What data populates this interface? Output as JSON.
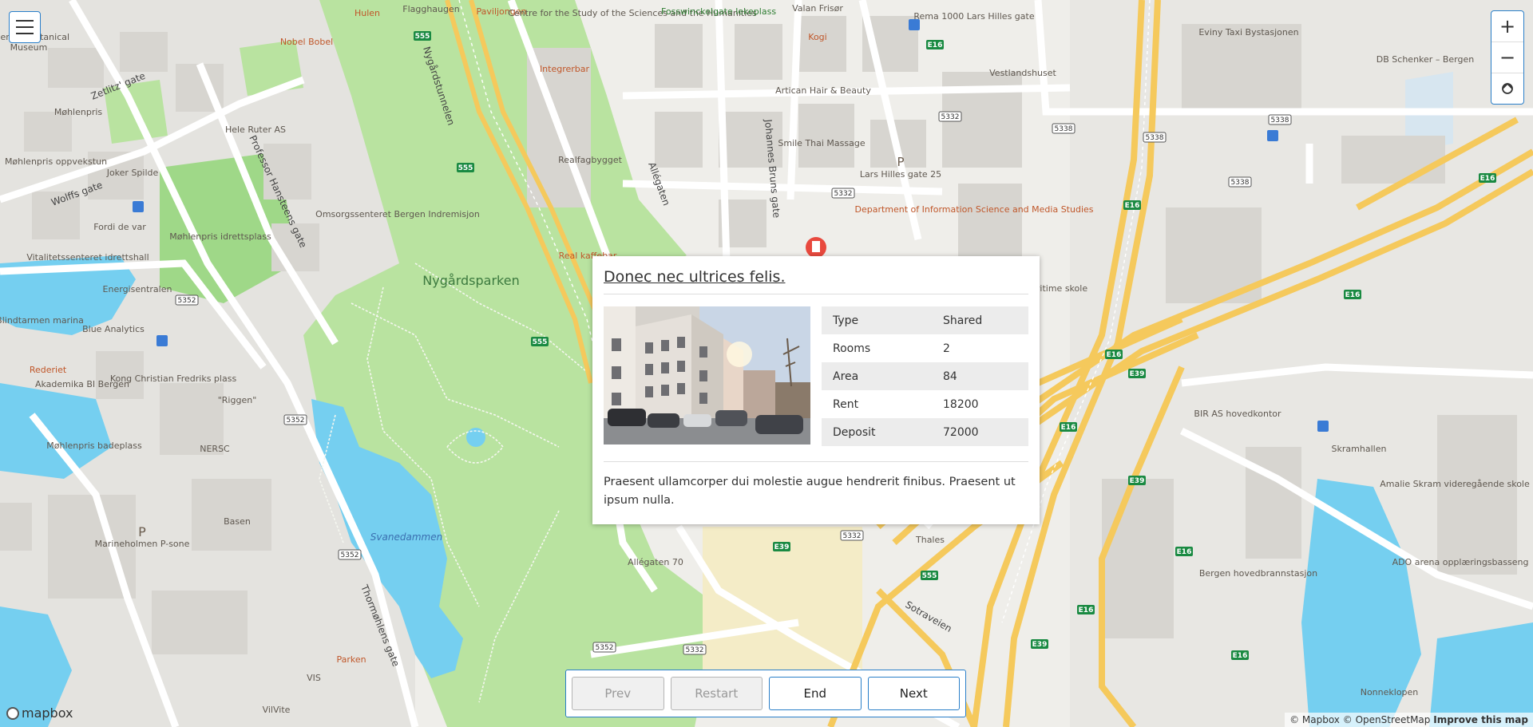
{
  "map": {
    "park_name": "Nygårdsparken",
    "lake_name": "Svanedammen",
    "streets": [
      "Nygårdstunnelen",
      "Professor Hansteens gate",
      "Johannes Bruns gate",
      "Allégaten",
      "Thormøhlens gate",
      "Sotraveien",
      "Zetlitz' gate",
      "Wolffs gate"
    ],
    "labels": [
      {
        "text": "Hulen",
        "kind": "food"
      },
      {
        "text": "Flagghaugen",
        "kind": "plain"
      },
      {
        "text": "Paviljongen",
        "kind": "food"
      },
      {
        "text": "Centre for the Study of the Sciences and the Humanities",
        "kind": "plain"
      },
      {
        "text": "Fosswinckelgate lekeplass",
        "kind": "green"
      },
      {
        "text": "Valan Frisør",
        "kind": "plain"
      },
      {
        "text": "Kogi",
        "kind": "food"
      },
      {
        "text": "Rema 1000 Lars Hilles gate",
        "kind": "plain"
      },
      {
        "text": "Eviny Taxi Bystasjonen",
        "kind": "plain"
      },
      {
        "text": "DB Schenker – Bergen",
        "kind": "plain"
      },
      {
        "text": "Nobel Bobel",
        "kind": "food"
      },
      {
        "text": "Integrerbar",
        "kind": "food"
      },
      {
        "text": "Vestlandshuset",
        "kind": "plain"
      },
      {
        "text": "Artican Hair & Beauty",
        "kind": "plain"
      },
      {
        "text": "Møhlenpris",
        "kind": "plain"
      },
      {
        "text": "Hele Ruter AS",
        "kind": "plain"
      },
      {
        "text": "Smile Thai Massage",
        "kind": "plain"
      },
      {
        "text": "Realfagbygget",
        "kind": "plain"
      },
      {
        "text": "Lars Hilles gate 25",
        "kind": "plain"
      },
      {
        "text": "Møhlenpris oppvekstun",
        "kind": "plain"
      },
      {
        "text": "Joker Spilde",
        "kind": "plain"
      },
      {
        "text": "Department of Information Science and Media Studies",
        "kind": "plain"
      },
      {
        "text": "Fordi de var",
        "kind": "plain"
      },
      {
        "text": "Møhlenpris idrettsplass",
        "kind": "plain"
      },
      {
        "text": "Omsorgssenteret Bergen Indremisjon",
        "kind": "plain"
      },
      {
        "text": "Real kaffebar",
        "kind": "food"
      },
      {
        "text": "Vitalitetssenteret idrettshall",
        "kind": "plain"
      },
      {
        "text": "Energisentralen",
        "kind": "plain"
      },
      {
        "text": "Blindtarmen marina",
        "kind": "plain"
      },
      {
        "text": "Blue Analytics",
        "kind": "plain"
      },
      {
        "text": "Rederiet",
        "kind": "food"
      },
      {
        "text": "Akademika BI Bergen",
        "kind": "plain"
      },
      {
        "text": "Kong Christian Fredriks plass",
        "kind": "plain"
      },
      {
        "text": "\"Riggen\"",
        "kind": "plain"
      },
      {
        "text": "Møhlenpris badeplass",
        "kind": "plain"
      },
      {
        "text": "NERSC",
        "kind": "plain"
      },
      {
        "text": "Basen",
        "kind": "plain"
      },
      {
        "text": "Marineholmen P-sone",
        "kind": "plain"
      },
      {
        "text": "Allégaten 70",
        "kind": "plain"
      },
      {
        "text": "Thales",
        "kind": "plain"
      },
      {
        "text": "Parken",
        "kind": "food"
      },
      {
        "text": "VIS",
        "kind": "plain"
      },
      {
        "text": "VilVite",
        "kind": "plain"
      },
      {
        "text": "BIR AS hovedkontor",
        "kind": "plain"
      },
      {
        "text": "Skramhallen",
        "kind": "plain"
      },
      {
        "text": "Amalie Skram videregående skole",
        "kind": "plain"
      },
      {
        "text": "Bergen hovedbrannstasjon",
        "kind": "plain"
      },
      {
        "text": "ADO arena opplæringsbasseng",
        "kind": "plain"
      },
      {
        "text": "Nonneklopen",
        "kind": "plain"
      },
      {
        "text": "Museum",
        "kind": "plain"
      },
      {
        "text": "Bergen Botanical",
        "kind": "plain"
      },
      {
        "text": "ritime skole",
        "kind": "plain"
      }
    ],
    "road_shields": [
      "555",
      "5332",
      "5338",
      "5352",
      "E16",
      "E39"
    ]
  },
  "controls": {
    "zoom_in": "+",
    "zoom_out": "−",
    "reset_bearing_icon": "compass-reset-icon",
    "menu_icon": "hamburger-menu-icon"
  },
  "popup": {
    "title": "Donec nec ultrices felis.",
    "table": [
      {
        "label": "Type",
        "value": "Shared"
      },
      {
        "label": "Rooms",
        "value": "2"
      },
      {
        "label": "Area",
        "value": "84"
      },
      {
        "label": "Rent",
        "value": "18200"
      },
      {
        "label": "Deposit",
        "value": "72000"
      }
    ],
    "description": "Praesent ullamcorper dui molestie augue hendrerit finibus. Praesent ut ipsum nulla."
  },
  "navigation": {
    "prev": "Prev",
    "restart": "Restart",
    "end": "End",
    "next": "Next"
  },
  "footer": {
    "logo": "mapbox",
    "attribution_mapbox": "© Mapbox",
    "attribution_osm": "© OpenStreetMap",
    "improve": "Improve this map"
  },
  "colors": {
    "park": "#b9e3a0",
    "water": "#75cff0",
    "highway": "#f5c95c",
    "land": "#efeeea",
    "building": "#dcdad5",
    "accent": "#2a7fc9"
  }
}
